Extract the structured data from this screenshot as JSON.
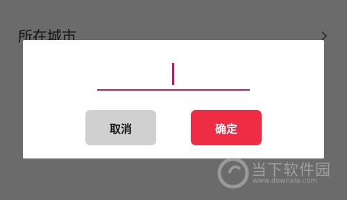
{
  "background": {
    "row_label": "所在城市"
  },
  "dialog": {
    "input": {
      "value": "",
      "placeholder": ""
    },
    "cancel_label": "取消",
    "confirm_label": "确定"
  },
  "watermark": {
    "name": "当下软件园",
    "url": "www.downxia.com"
  },
  "colors": {
    "accent": "#c2185b",
    "confirm": "#ee2d45",
    "cancel": "#d0d0d0",
    "overlay": "#6b6b6b"
  }
}
